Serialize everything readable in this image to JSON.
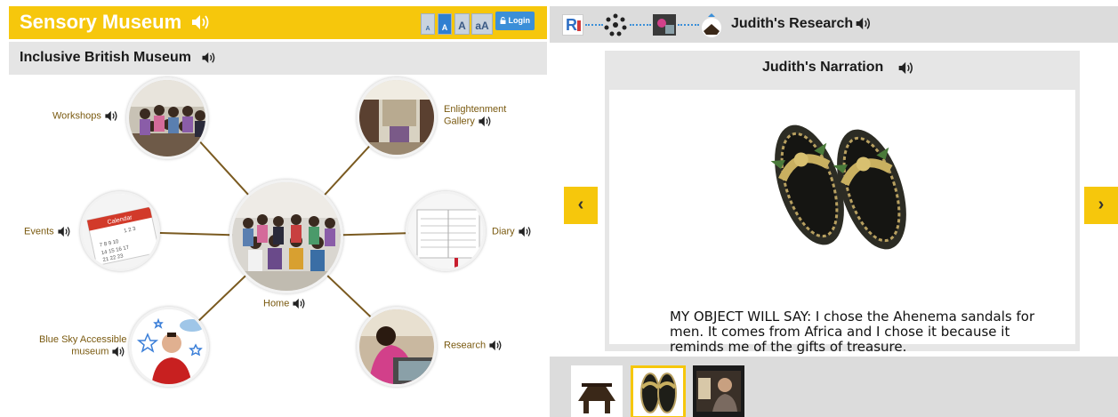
{
  "left_panel": {
    "site_title": "Sensory Museum",
    "museum_title": "Inclusive British Museum",
    "font_buttons": [
      "A",
      "A",
      "A",
      "aA"
    ],
    "login_label": "Login",
    "nodes": {
      "workshops": "Workshops",
      "enlightenment": [
        "Enlightenment",
        "Gallery"
      ],
      "events": "Events",
      "events_calendar": "Calendar",
      "diary": "Diary",
      "home": "Home",
      "blue_sky": [
        "Blue Sky Accessible",
        "museum"
      ],
      "research": "Research"
    }
  },
  "right_panel": {
    "breadcrumb_logo": "R",
    "title": "Judith's Research",
    "narration_title": "Judith's Narration",
    "narration_text": "MY OBJECT WILL SAY: I chose the Ahenema sandals for men. It comes from Africa and I chose it because it reminds me of the gifts of treasure.",
    "prev_icon": "‹",
    "next_icon": "›"
  },
  "icons": {
    "speaker": "speaker-icon",
    "lock": "lock-icon"
  },
  "colors": {
    "accent_yellow": "#f6c70c",
    "link_blue": "#3b8fd8",
    "label_brown": "#7a5a10",
    "bar_gray": "#e5e5e5"
  }
}
